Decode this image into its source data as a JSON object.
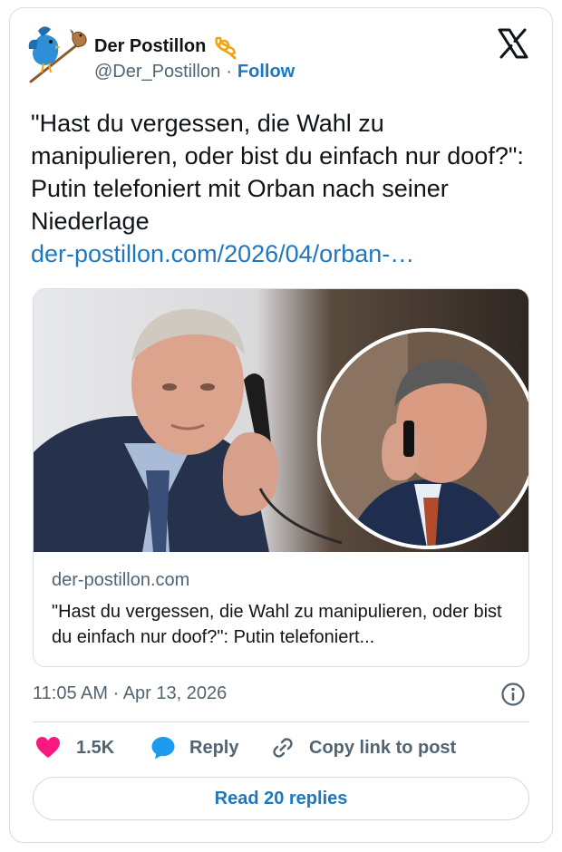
{
  "author": {
    "name": "Der Postillon",
    "handle": "@Der_Postillon",
    "separator": "·",
    "follow_label": "Follow"
  },
  "tweet": {
    "text": "\"Hast du vergessen, die Wahl zu manipulieren, oder bist du einfach nur doof?\": Putin telefoniert mit Orban nach seiner Niederlage",
    "link": "der-postillon.com/2026/04/orban-…"
  },
  "link_card": {
    "domain": "der-postillon.com",
    "title": "\"Hast du vergessen, die Wahl zu manipulieren, oder bist du einfach nur doof?\": Putin telefoniert..."
  },
  "meta": {
    "timestamp": "11:05 AM · Apr 13, 2026"
  },
  "actions": {
    "like_count": "1.5K",
    "reply_label": "Reply",
    "copy_link_label": "Copy link to post",
    "read_replies_label": "Read 20 replies"
  },
  "icons": {
    "like": "heart-icon",
    "reply": "speech-bubble-icon",
    "copy": "link-icon",
    "info": "info-icon",
    "brand": "x-logo-icon"
  },
  "colors": {
    "like": "#f91880",
    "reply": "#1d9bf0",
    "link": "#1d78c1",
    "muted": "#536471"
  }
}
